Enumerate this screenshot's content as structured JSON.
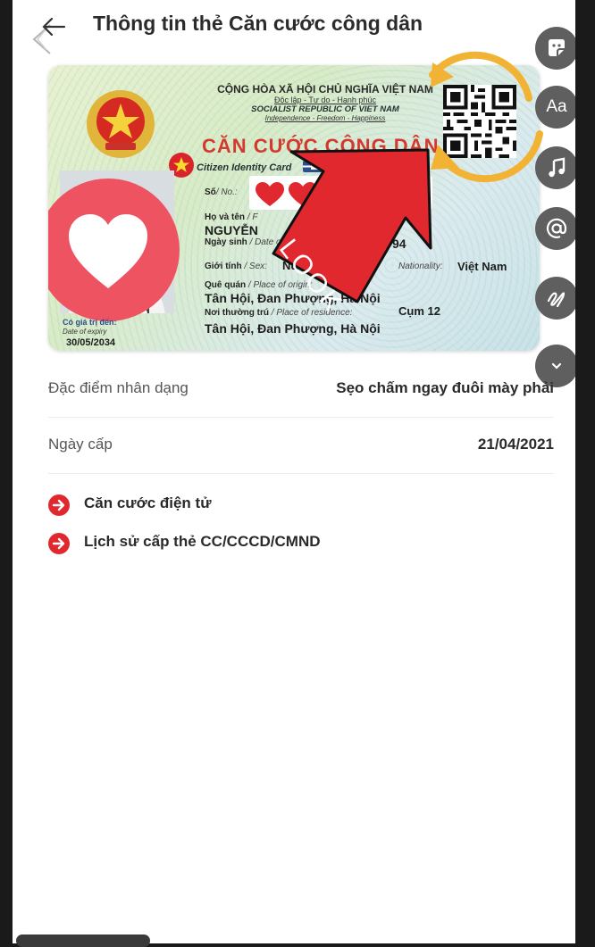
{
  "header": {
    "title": "Thông tin thẻ Căn cước công dân"
  },
  "card": {
    "nation": "CỘNG HÒA XÃ HỘI CHỦ NGHĨA VIỆT NAM",
    "motto": "Độc lập - Tự do - Hạnh phúc",
    "nation_en": "SOCIALIST REPUBLIC OF VIET NAM",
    "motto_en": "Independence - Freedom - Happiness",
    "title": "CĂN CƯỚC CÔNG DÂN",
    "title_en": "Citizen Identity Card",
    "number_label": "Số",
    "number_label_en": "/ No.:",
    "name_label": "Họ và tên",
    "name_label_en": "/ F",
    "name_value": "NGUYỄN",
    "dob_label": "Ngày sinh",
    "dob_label_en": "/ Date o",
    "dob_value": "94",
    "sex_label": "Giới tính",
    "sex_label_en": "/ Sex:",
    "sex_value": "Nữ",
    "nationality_label_en": "Nationality:",
    "nationality_value": "Việt Nam",
    "origin_label": "Quê quán",
    "origin_label_en": "/ Place of origin:",
    "origin_value": "Tân Hội, Đan Phượng, Hà Nội",
    "residence_label": "Nơi thường trú",
    "residence_label_en": "/ Place of residence:",
    "residence_value_1": "Cụm 12",
    "residence_value_2": "Tân Hội, Đan Phượng, Hà Nội",
    "expiry_label": "Có giá trị đến:",
    "expiry_label_en": "Date of expiry",
    "expiry_value": "30/05/2034"
  },
  "overlay": {
    "arrow_text": "LOOK"
  },
  "rail": {
    "text_tool_label": "Aa"
  },
  "rows": [
    {
      "label": "Đặc điểm nhân dạng",
      "value": "Sẹo chấm ngay đuôi mày phải"
    },
    {
      "label": "Ngày cấp",
      "value": "21/04/2021"
    }
  ],
  "links": [
    {
      "label": "Căn cước điện tử"
    },
    {
      "label": "Lịch sử cấp thẻ CC/CCCD/CMND"
    }
  ],
  "colors": {
    "accent": "#e0282e",
    "card_title": "#d23a2f",
    "rail": "#5f5f5f",
    "highlight": "#f2b233"
  }
}
